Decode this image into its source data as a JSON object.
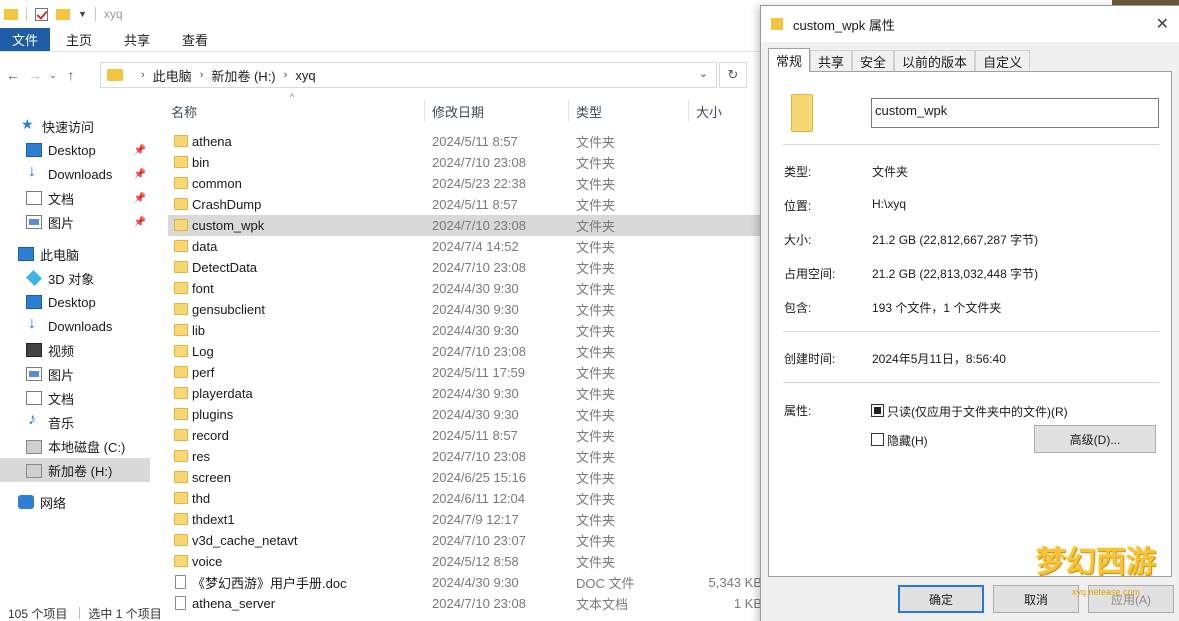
{
  "window": {
    "title": "xyq",
    "ribbon_tabs": [
      "文件",
      "主页",
      "共享",
      "查看"
    ]
  },
  "address": {
    "crumbs": [
      "此电脑",
      "新加卷 (H:)",
      "xyq"
    ]
  },
  "sidebar": {
    "items": [
      {
        "label": "快速访问",
        "icon": "star-icon"
      },
      {
        "label": "Desktop",
        "icon": "desktop-icon",
        "pinned": true
      },
      {
        "label": "Downloads",
        "icon": "downloads-icon",
        "pinned": true
      },
      {
        "label": "文档",
        "icon": "documents-icon",
        "pinned": true
      },
      {
        "label": "图片",
        "icon": "pictures-icon",
        "pinned": true
      },
      {
        "label": "此电脑",
        "icon": "pc-icon"
      },
      {
        "label": "3D 对象",
        "icon": "3d-objects-icon"
      },
      {
        "label": "Desktop",
        "icon": "desktop-icon"
      },
      {
        "label": "Downloads",
        "icon": "downloads-icon"
      },
      {
        "label": "视频",
        "icon": "videos-icon"
      },
      {
        "label": "图片",
        "icon": "pictures-icon"
      },
      {
        "label": "文档",
        "icon": "documents-icon"
      },
      {
        "label": "音乐",
        "icon": "music-icon"
      },
      {
        "label": "本地磁盘 (C:)",
        "icon": "disk-icon"
      },
      {
        "label": "新加卷 (H:)",
        "icon": "disk-icon",
        "selected": true
      },
      {
        "label": "网络",
        "icon": "network-icon"
      }
    ]
  },
  "columns": {
    "name": "名称",
    "date": "修改日期",
    "type": "类型",
    "size": "大小"
  },
  "files": [
    {
      "name": "athena",
      "date": "2024/5/11 8:57",
      "type": "文件夹",
      "size": ""
    },
    {
      "name": "bin",
      "date": "2024/7/10 23:08",
      "type": "文件夹",
      "size": ""
    },
    {
      "name": "common",
      "date": "2024/5/23 22:38",
      "type": "文件夹",
      "size": ""
    },
    {
      "name": "CrashDump",
      "date": "2024/5/11 8:57",
      "type": "文件夹",
      "size": ""
    },
    {
      "name": "custom_wpk",
      "date": "2024/7/10 23:08",
      "type": "文件夹",
      "size": "",
      "selected": true
    },
    {
      "name": "data",
      "date": "2024/7/4 14:52",
      "type": "文件夹",
      "size": ""
    },
    {
      "name": "DetectData",
      "date": "2024/7/10 23:08",
      "type": "文件夹",
      "size": ""
    },
    {
      "name": "font",
      "date": "2024/4/30 9:30",
      "type": "文件夹",
      "size": ""
    },
    {
      "name": "gensubclient",
      "date": "2024/4/30 9:30",
      "type": "文件夹",
      "size": ""
    },
    {
      "name": "lib",
      "date": "2024/4/30 9:30",
      "type": "文件夹",
      "size": ""
    },
    {
      "name": "Log",
      "date": "2024/7/10 23:08",
      "type": "文件夹",
      "size": ""
    },
    {
      "name": "perf",
      "date": "2024/5/11 17:59",
      "type": "文件夹",
      "size": ""
    },
    {
      "name": "playerdata",
      "date": "2024/4/30 9:30",
      "type": "文件夹",
      "size": ""
    },
    {
      "name": "plugins",
      "date": "2024/4/30 9:30",
      "type": "文件夹",
      "size": ""
    },
    {
      "name": "record",
      "date": "2024/5/11 8:57",
      "type": "文件夹",
      "size": ""
    },
    {
      "name": "res",
      "date": "2024/7/10 23:08",
      "type": "文件夹",
      "size": ""
    },
    {
      "name": "screen",
      "date": "2024/6/25 15:16",
      "type": "文件夹",
      "size": ""
    },
    {
      "name": "thd",
      "date": "2024/6/11 12:04",
      "type": "文件夹",
      "size": ""
    },
    {
      "name": "thdext1",
      "date": "2024/7/9 12:17",
      "type": "文件夹",
      "size": ""
    },
    {
      "name": "v3d_cache_netavt",
      "date": "2024/7/10 23:07",
      "type": "文件夹",
      "size": ""
    },
    {
      "name": "voice",
      "date": "2024/5/12 8:58",
      "type": "文件夹",
      "size": ""
    },
    {
      "name": "《梦幻西游》用户手册.doc",
      "date": "2024/4/30 9:30",
      "type": "DOC 文件",
      "size": "5,343 KB"
    },
    {
      "name": "athena_server",
      "date": "2024/7/10 23:08",
      "type": "文本文档",
      "size": "1 KB"
    }
  ],
  "status": {
    "count": "105 个项目",
    "selected": "选中 1 个项目"
  },
  "dialog": {
    "title": "custom_wpk 属性",
    "tabs": [
      "常规",
      "共享",
      "安全",
      "以前的版本",
      "自定义"
    ],
    "folder_name": "custom_wpk",
    "props": [
      {
        "label": "类型:",
        "value": "文件夹"
      },
      {
        "label": "位置:",
        "value": "H:\\xyq"
      },
      {
        "label": "大小:",
        "value": "21.2 GB (22,812,667,287 字节)"
      },
      {
        "label": "占用空间:",
        "value": "21.2 GB (22,813,032,448 字节)"
      },
      {
        "label": "包含:",
        "value": "193 个文件，1 个文件夹"
      }
    ],
    "created_label": "创建时间:",
    "created_value": "2024年5月11日，8:56:40",
    "attr_label": "属性:",
    "readonly_label": "只读(仅应用于文件夹中的文件)(R)",
    "hidden_label": "隐藏(H)",
    "advanced_label": "高级(D)...",
    "ok_label": "确定",
    "cancel_label": "取消",
    "apply_label": "应用(A)"
  },
  "watermark": {
    "title": "梦幻西游",
    "url": "xyq.netease.com"
  }
}
